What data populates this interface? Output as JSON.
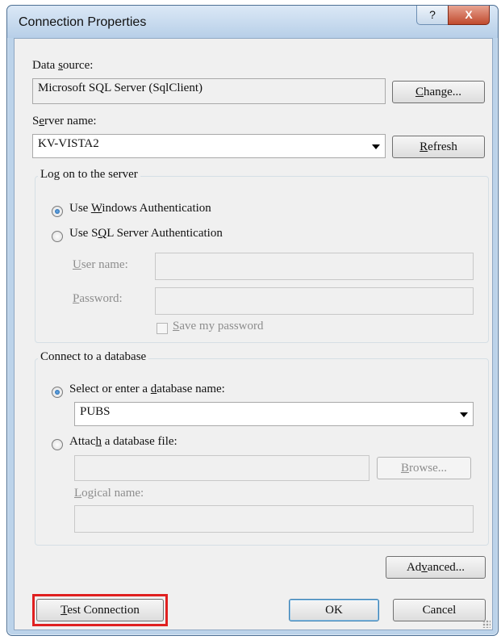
{
  "window": {
    "title": "Connection Properties",
    "help_glyph": "?",
    "close_glyph": "X"
  },
  "data_source": {
    "label_pre": "Data ",
    "label_u": "s",
    "label_post": "ource:",
    "value": "Microsoft SQL Server (SqlClient)",
    "change_pre": "",
    "change_u": "C",
    "change_post": "hange..."
  },
  "server": {
    "label_pre": "S",
    "label_u": "e",
    "label_post": "rver name:",
    "value": "KV-VISTA2",
    "refresh_pre": "",
    "refresh_u": "R",
    "refresh_post": "efresh"
  },
  "logon": {
    "group_title": "Log on to the server",
    "windows_auth_pre": "Use ",
    "windows_auth_u": "W",
    "windows_auth_post": "indows Authentication",
    "sql_auth_pre": "Use S",
    "sql_auth_u": "Q",
    "sql_auth_post": "L Server Authentication",
    "username_pre": "",
    "username_u": "U",
    "username_post": "ser name:",
    "username_value": "",
    "password_pre": "",
    "password_u": "P",
    "password_post": "assword:",
    "password_value": "",
    "save_pre": "",
    "save_u": "S",
    "save_post": "ave my password"
  },
  "database": {
    "group_title": "Connect to a database",
    "select_pre": "Select or enter a ",
    "select_u": "d",
    "select_post": "atabase name:",
    "db_value": "PUBS",
    "attach_pre": "Attac",
    "attach_u": "h",
    "attach_post": " a database file:",
    "attach_value": "",
    "browse_pre": "",
    "browse_u": "B",
    "browse_post": "rowse...",
    "logical_pre": "",
    "logical_u": "L",
    "logical_post": "ogical name:",
    "logical_value": ""
  },
  "footer": {
    "advanced_pre": "Ad",
    "advanced_u": "v",
    "advanced_post": "anced...",
    "test_pre": "",
    "test_u": "T",
    "test_post": "est Connection",
    "ok": "OK",
    "cancel": "Cancel"
  },
  "colors": {
    "highlight": "#e02020",
    "close_button": "#c04a2e"
  }
}
